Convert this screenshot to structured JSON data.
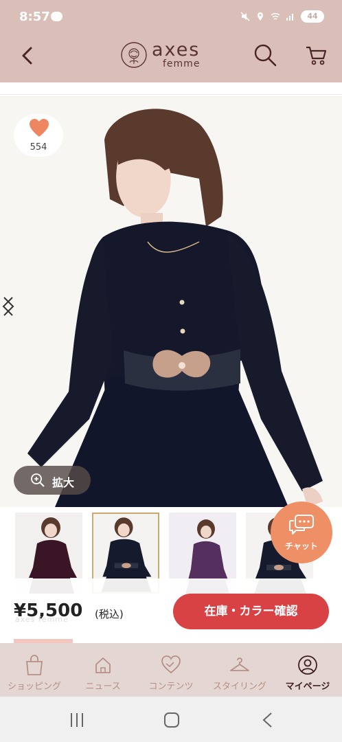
{
  "status": {
    "time": "8:57",
    "battery": "44"
  },
  "header": {
    "brand": "axes",
    "brand_sub": "femme"
  },
  "product": {
    "favorite_count": "554",
    "zoom_label": "拡大",
    "price": "¥5,500",
    "tax_note": "(税込)",
    "ghost_brand": "axes femme",
    "stock_button": "在庫・カラー確認"
  },
  "chat": {
    "label": "チャット"
  },
  "thumbnails": [
    {
      "color": "bordeaux",
      "selected": false
    },
    {
      "color": "navy",
      "selected": true
    },
    {
      "color": "purple",
      "selected": false
    },
    {
      "color": "navy",
      "selected": false
    }
  ],
  "bottom_nav": [
    {
      "label": "ショッピング",
      "icon": "shopping-bag-icon"
    },
    {
      "label": "ニュース",
      "icon": "home-icon"
    },
    {
      "label": "コンテンツ",
      "icon": "heart-hands-icon"
    },
    {
      "label": "スタイリング",
      "icon": "hanger-icon"
    },
    {
      "label": "マイページ",
      "icon": "user-icon",
      "active": true
    }
  ],
  "colors": {
    "header": "#d9bfb8",
    "accent": "#d84244",
    "chat": "#ee8f66",
    "nav_bg": "#e4d7d3"
  }
}
